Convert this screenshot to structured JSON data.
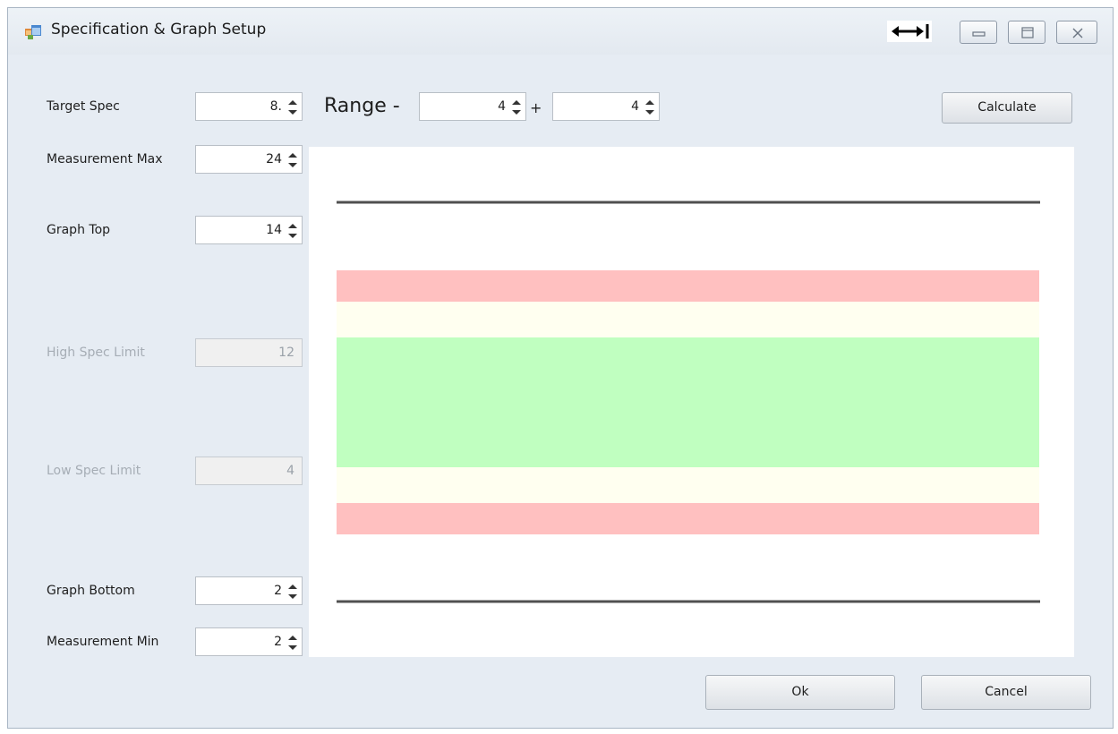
{
  "window": {
    "title": "Specification & Graph Setup",
    "icons": {
      "app": "app-window-icon",
      "resize": "resize-horizontal-icon",
      "minimize": "minimize-icon",
      "maximize": "maximize-icon",
      "close": "close-icon"
    }
  },
  "fields": {
    "target_spec": {
      "label": "Target Spec",
      "value": "8."
    },
    "measurement_max": {
      "label": "Measurement Max",
      "value": "24"
    },
    "graph_top": {
      "label": "Graph Top",
      "value": "14"
    },
    "high_spec_limit": {
      "label": "High Spec Limit",
      "value": "12"
    },
    "low_spec_limit": {
      "label": "Low Spec Limit",
      "value": "4"
    },
    "graph_bottom": {
      "label": "Graph Bottom",
      "value": "2"
    },
    "measurement_min": {
      "label": "Measurement Min",
      "value": "2"
    }
  },
  "range": {
    "label": "Range -",
    "minus_value": "4",
    "plus_label": "+",
    "plus_value": "4"
  },
  "buttons": {
    "calculate": "Calculate",
    "ok": "Ok",
    "cancel": "Cancel"
  },
  "colors": {
    "window_bg": "#e6ecf3",
    "reject_band": "#ffc0c0",
    "warning_band": "#fffff0",
    "target_band": "#c0ffc0",
    "graph_line": "#505050"
  }
}
